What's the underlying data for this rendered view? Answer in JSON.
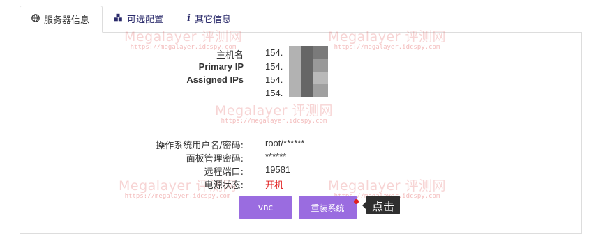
{
  "tabs": [
    {
      "label": "服务器信息",
      "icon": "globe-icon",
      "active": true
    },
    {
      "label": "可选配置",
      "icon": "cubes-icon",
      "active": false
    },
    {
      "label": "其它信息",
      "icon": "info-icon",
      "active": false
    }
  ],
  "watermark": {
    "title": "Megalayer 评测网",
    "url": "https://megalayer.idcspy.com"
  },
  "network": {
    "hostname_label": "主机名",
    "primary_ip_label": "Primary IP",
    "assigned_ips_label": "Assigned IPs",
    "hostname_value": "154.",
    "primary_ip_value": "154.",
    "assigned_ip_1": "154.",
    "assigned_ip_2": "154."
  },
  "access": {
    "os_credentials_label": "操作系统用户名/密码:",
    "os_credentials_value": "root/******",
    "panel_password_label": "面板管理密码:",
    "panel_password_value": "******",
    "remote_port_label": "远程端口:",
    "remote_port_value": "19581",
    "power_state_label": "电源状态:",
    "power_state_value": "开机"
  },
  "buttons": {
    "vnc": "vnc",
    "reinstall": "重装系统"
  },
  "tooltip": {
    "text": "点击"
  },
  "colors": {
    "accent": "#9a6ce0",
    "status_on": "#e01818",
    "tab_text": "#2b2b6b",
    "tooltip_bg": "#2f2f2f"
  }
}
